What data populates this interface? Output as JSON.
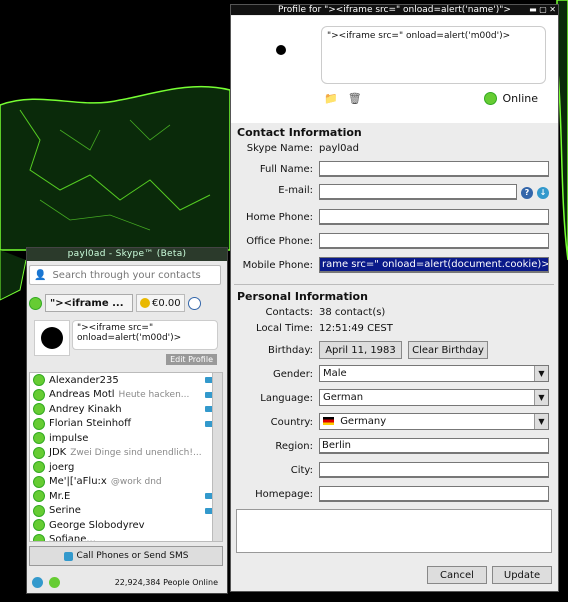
{
  "skype": {
    "title": "payl0ad - Skype™ (Beta)",
    "search_placeholder": "Search through your contacts",
    "mood_button": "\"><iframe ...",
    "credit": "€0.00",
    "mood_message": "\"><iframe src=\" onload=alert('m00d')>",
    "edit_profile": "Edit Profile",
    "contacts": [
      {
        "name": "Alexander235",
        "mood": "",
        "video": true
      },
      {
        "name": "Andreas Motl",
        "mood": "Heute hacken...",
        "video": true
      },
      {
        "name": "Andrey Kinakh",
        "mood": "",
        "video": true
      },
      {
        "name": "Florian Steinhoff",
        "mood": "",
        "video": true
      },
      {
        "name": "impulse",
        "mood": "",
        "video": false
      },
      {
        "name": "JDK",
        "mood": "Zwei Dinge sind unendlich!...",
        "video": false
      },
      {
        "name": "joerg",
        "mood": "",
        "video": false
      },
      {
        "name": "Me'|['aFlu:x",
        "mood": "@work dnd",
        "video": false
      },
      {
        "name": "Mr.E",
        "mood": "",
        "video": true
      },
      {
        "name": "Serine",
        "mood": "",
        "video": true
      },
      {
        "name": "George Slobodyrev",
        "mood": "",
        "video": false
      },
      {
        "name": "Sofiane...",
        "mood": "",
        "video": false
      }
    ],
    "call_button": "Call Phones or Send SMS",
    "people_online": "22,924,384 People Online"
  },
  "profile": {
    "title": "Profile for \"><iframe src=\" onload=alert('name')\">",
    "mood": "\"><iframe src=\" onload=alert('m00d')>",
    "status": "Online",
    "contact_info_heading": "Contact Information",
    "skype_name_label": "Skype Name:",
    "skype_name": "payl0ad",
    "full_name_label": "Full Name:",
    "email_label": "E-mail:",
    "home_phone_label": "Home Phone:",
    "office_phone_label": "Office Phone:",
    "mobile_phone_label": "Mobile Phone:",
    "mobile_phone": "rame src=\" onload=alert(document.cookie)>",
    "personal_info_heading": "Personal Information",
    "contacts_label": "Contacts:",
    "contacts_value": "38 contact(s)",
    "local_time_label": "Local Time:",
    "local_time": "12:51:49 CEST",
    "birthday_label": "Birthday:",
    "birthday": "April 11, 1983",
    "clear_birthday": "Clear Birthday",
    "gender_label": "Gender:",
    "gender": "Male",
    "language_label": "Language:",
    "language": "German",
    "country_label": "Country:",
    "country": "Germany",
    "region_label": "Region:",
    "region": "Berlin",
    "city_label": "City:",
    "homepage_label": "Homepage:",
    "cancel": "Cancel",
    "update": "Update"
  }
}
